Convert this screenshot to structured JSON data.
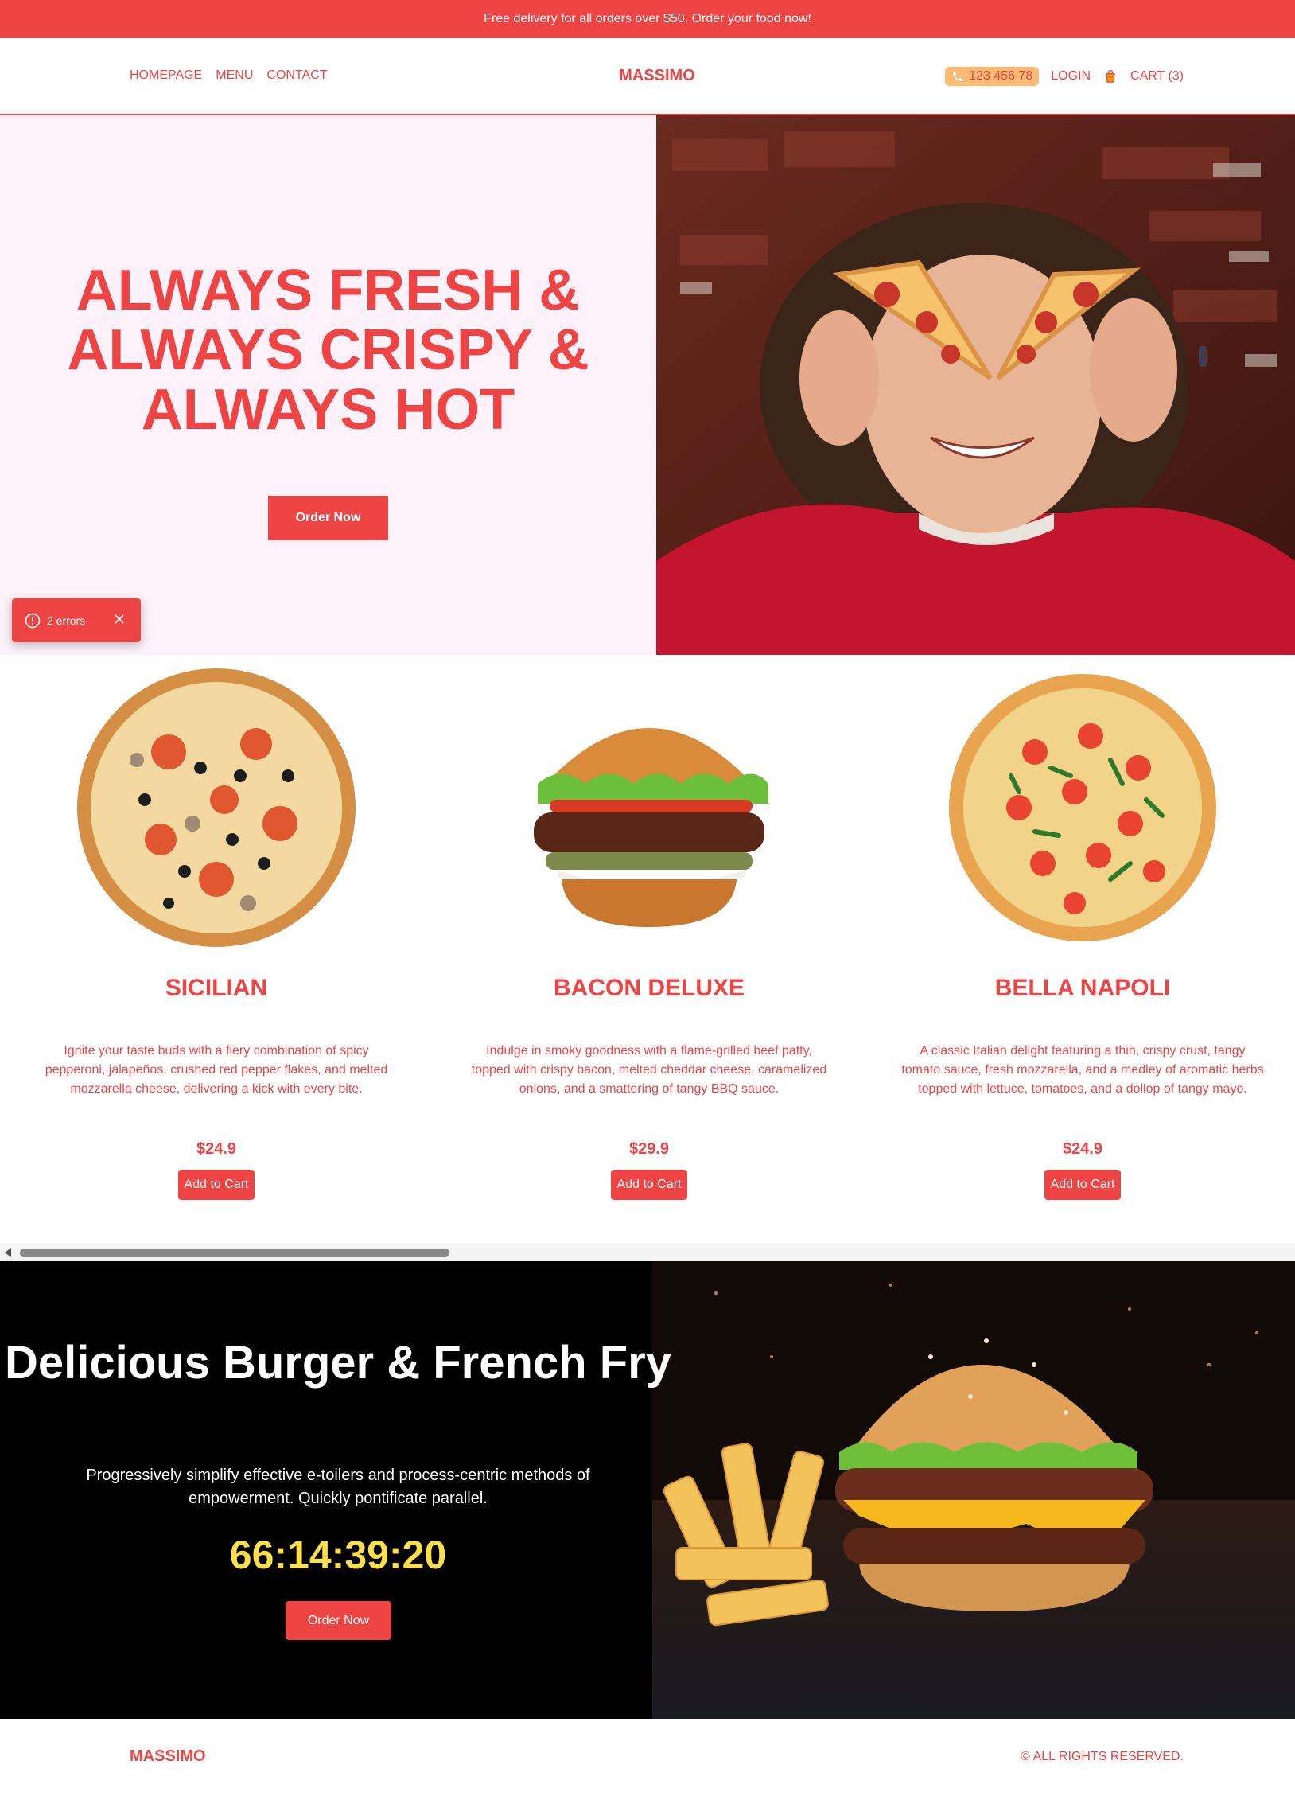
{
  "announcement": "Free delivery for all orders over $50. Order your food now!",
  "nav": {
    "links": [
      "HOMEPAGE",
      "MENU",
      "CONTACT"
    ],
    "brand": "MASSIMO",
    "phone": "123 456 78",
    "login": "LOGIN",
    "cart": "CART (3)"
  },
  "hero": {
    "title_lines": [
      "ALWAYS FRESH &",
      "ALWAYS CRISPY &",
      "ALWAYS HOT"
    ],
    "cta": "Order Now"
  },
  "errors_toast": {
    "label": "2 errors"
  },
  "products": [
    {
      "name": "SICILIAN",
      "description": "Ignite your taste buds with a fiery combination of spicy pepperoni, jalapeños, crushed red pepper flakes, and melted mozzarella cheese, delivering a kick with every bite.",
      "price": "$24.9",
      "button": "Add to Cart"
    },
    {
      "name": "BACON DELUXE",
      "description": "Indulge in smoky goodness with a flame-grilled beef patty, topped with crispy bacon, melted cheddar cheese, caramelized onions, and a smattering of tangy BBQ sauce.",
      "price": "$29.9",
      "button": "Add to Cart"
    },
    {
      "name": "BELLA NAPOLI",
      "description": "A classic Italian delight featuring a thin, crispy crust, tangy tomato sauce, fresh mozzarella, and a medley of aromatic herbs topped with lettuce, tomatoes, and a dollop of tangy mayo.",
      "price": "$24.9",
      "button": "Add to Cart"
    }
  ],
  "promo": {
    "title": "Delicious Burger & French Fry",
    "text": "Progressively simplify effective e-toilers and process-centric methods of empowerment. Quickly pontificate parallel.",
    "countdown": "66:14:39:20",
    "cta": "Order Now"
  },
  "footer": {
    "brand": "MASSIMO",
    "copyright": "© ALL RIGHTS RESERVED."
  },
  "colors": {
    "accent": "#ef4444",
    "hero_bg": "#fdf2fa",
    "phone_bg": "#fdba74",
    "countdown": "#fde047"
  }
}
